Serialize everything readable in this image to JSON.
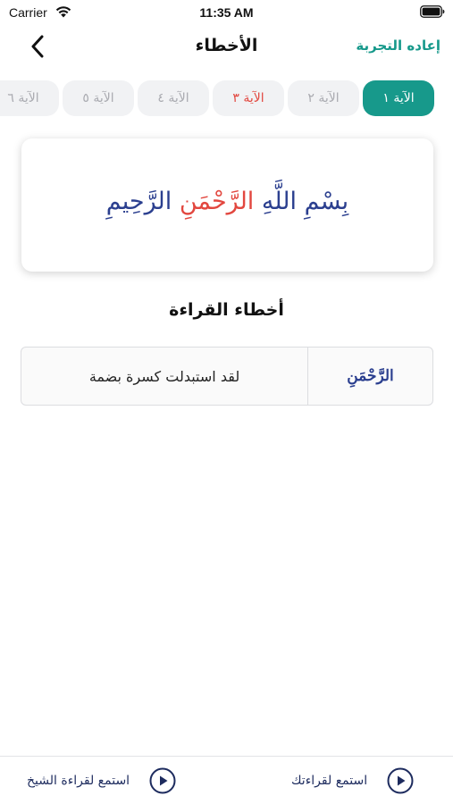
{
  "status_bar": {
    "carrier": "Carrier",
    "time": "11:35 AM"
  },
  "nav": {
    "title": "الأخطاء",
    "retry_label": "إعاده التجربة",
    "back_icon": "chevron-left-icon"
  },
  "tabs": [
    {
      "label": "الآية ١",
      "state": "active"
    },
    {
      "label": "الآية ٢",
      "state": "normal"
    },
    {
      "label": "الآية ٣",
      "state": "error"
    },
    {
      "label": "الآية ٤",
      "state": "normal"
    },
    {
      "label": "الآية ٥",
      "state": "normal"
    },
    {
      "label": "الآية ٦",
      "state": "normal"
    }
  ],
  "verse": {
    "before": "بِسْمِ اللَّهِ ",
    "error_word": "الرَّحْمَنِ",
    "after": " الرَّحِيمِ"
  },
  "errors_section": {
    "title": "أخطاء القراءة",
    "rows": [
      {
        "word": "الرَّحْمَنِ",
        "description": "لقد استبدلت كسرة بضمة"
      }
    ]
  },
  "bottom_bar": {
    "listen_sheikh_label": "استمع لقراءة الشيخ",
    "listen_mine_label": "استمع لقراءتك"
  },
  "colors": {
    "accent": "#17998b",
    "error": "#e2473f",
    "verse_text": "#2b3f8f",
    "navy": "#1d2b5e"
  }
}
